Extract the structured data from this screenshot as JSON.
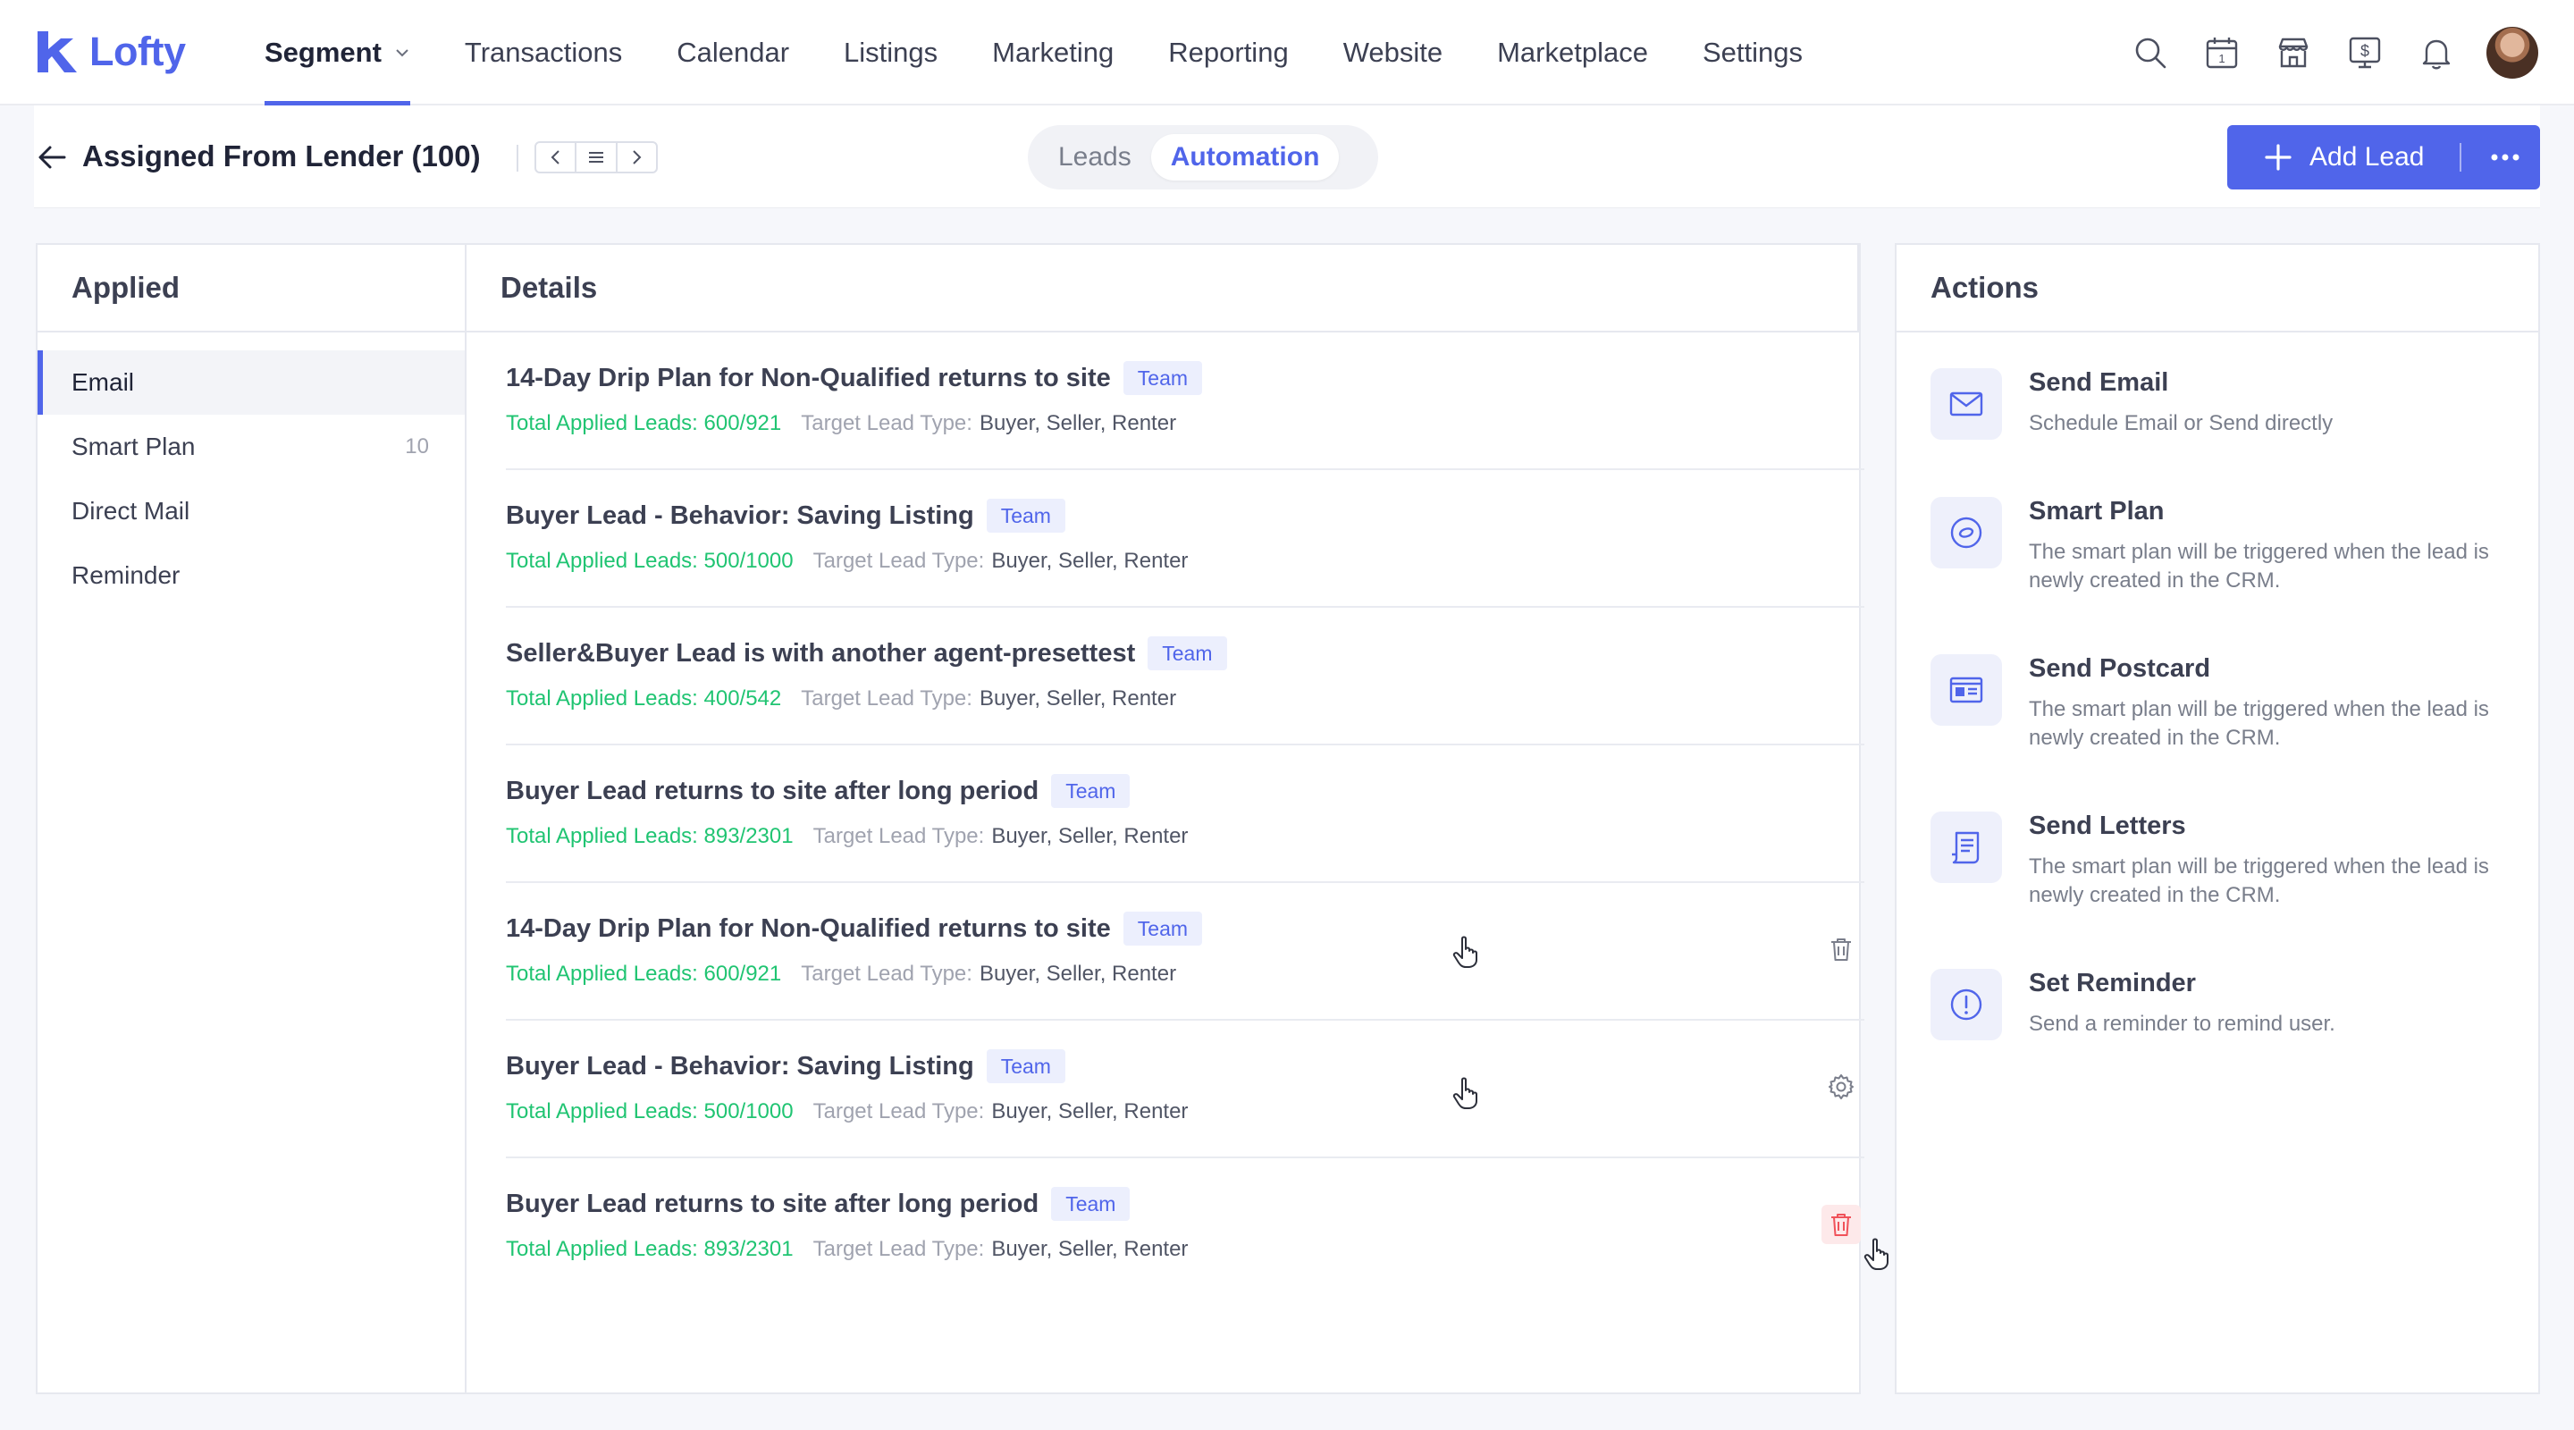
{
  "brand": {
    "name": "Lofty",
    "color": "#5065ea"
  },
  "nav": {
    "items": [
      {
        "label": "Segment",
        "active": true
      },
      {
        "label": "Transactions"
      },
      {
        "label": "Calendar"
      },
      {
        "label": "Listings"
      },
      {
        "label": "Marketing"
      },
      {
        "label": "Reporting"
      },
      {
        "label": "Website"
      },
      {
        "label": "Marketplace"
      },
      {
        "label": "Settings"
      }
    ],
    "icons": [
      "search-icon",
      "calendar-icon",
      "store-icon",
      "dollar-icon",
      "bell-icon"
    ],
    "calendar_day": "1"
  },
  "subheader": {
    "title": "Assigned From Lender (100)",
    "tabs": [
      {
        "label": "Leads"
      },
      {
        "label": "Automation",
        "active": true
      }
    ],
    "add_lead_label": "Add Lead"
  },
  "applied": {
    "heading": "Applied",
    "items": [
      {
        "label": "Email",
        "count": "",
        "active": true
      },
      {
        "label": "Smart Plan",
        "count": "10"
      },
      {
        "label": "Direct Mail",
        "count": ""
      },
      {
        "label": "Reminder",
        "count": ""
      }
    ]
  },
  "details": {
    "heading": "Details",
    "tag_label": "Team",
    "target_label": "Target Lead Type:",
    "rows": [
      {
        "title": "14-Day Drip Plan for Non-Qualified returns to site",
        "applied": "Total Applied Leads: 600/921",
        "types": "Buyer, Seller, Renter",
        "action": ""
      },
      {
        "title": "Buyer Lead - Behavior: Saving Listing",
        "applied": "Total Applied Leads: 500/1000",
        "types": "Buyer, Seller, Renter",
        "action": ""
      },
      {
        "title": "Seller&Buyer Lead is with another agent-presettest",
        "applied": "Total Applied Leads: 400/542",
        "types": "Buyer, Seller, Renter",
        "action": ""
      },
      {
        "title": "Buyer Lead returns to site after long period",
        "applied": "Total Applied Leads: 893/2301",
        "types": "Buyer, Seller, Renter",
        "action": ""
      },
      {
        "title": "14-Day Drip Plan for Non-Qualified returns to site",
        "applied": "Total Applied Leads: 600/921",
        "types": "Buyer, Seller, Renter",
        "action": "trash-icon"
      },
      {
        "title": "Buyer Lead - Behavior: Saving Listing",
        "applied": "Total Applied Leads: 500/1000",
        "types": "Buyer, Seller, Renter",
        "action": "gear-icon"
      },
      {
        "title": "Buyer Lead returns to site after long period",
        "applied": "Total Applied Leads: 893/2301",
        "types": "Buyer, Seller, Renter",
        "action": "trash-icon-danger"
      }
    ]
  },
  "actions": {
    "heading": "Actions",
    "items": [
      {
        "title": "Send Email",
        "desc": "Schedule Email or Send directly",
        "icon": "mail-icon"
      },
      {
        "title": "Smart Plan",
        "desc": "The smart plan will be triggered when the lead is newly created in the CRM.",
        "icon": "smart-plan-icon"
      },
      {
        "title": "Send Postcard",
        "desc": "The smart plan will be triggered when the lead is newly created in the CRM.",
        "icon": "postcard-icon"
      },
      {
        "title": "Send Letters",
        "desc": "The smart plan will be triggered when the lead is newly created in the CRM.",
        "icon": "letter-icon"
      },
      {
        "title": "Set Reminder",
        "desc": "Send a reminder to remind user.",
        "icon": "reminder-icon"
      }
    ]
  },
  "colors": {
    "accent": "#5065ea",
    "success": "#20c472",
    "danger": "#f0525a",
    "tag_bg": "#eceffd"
  }
}
